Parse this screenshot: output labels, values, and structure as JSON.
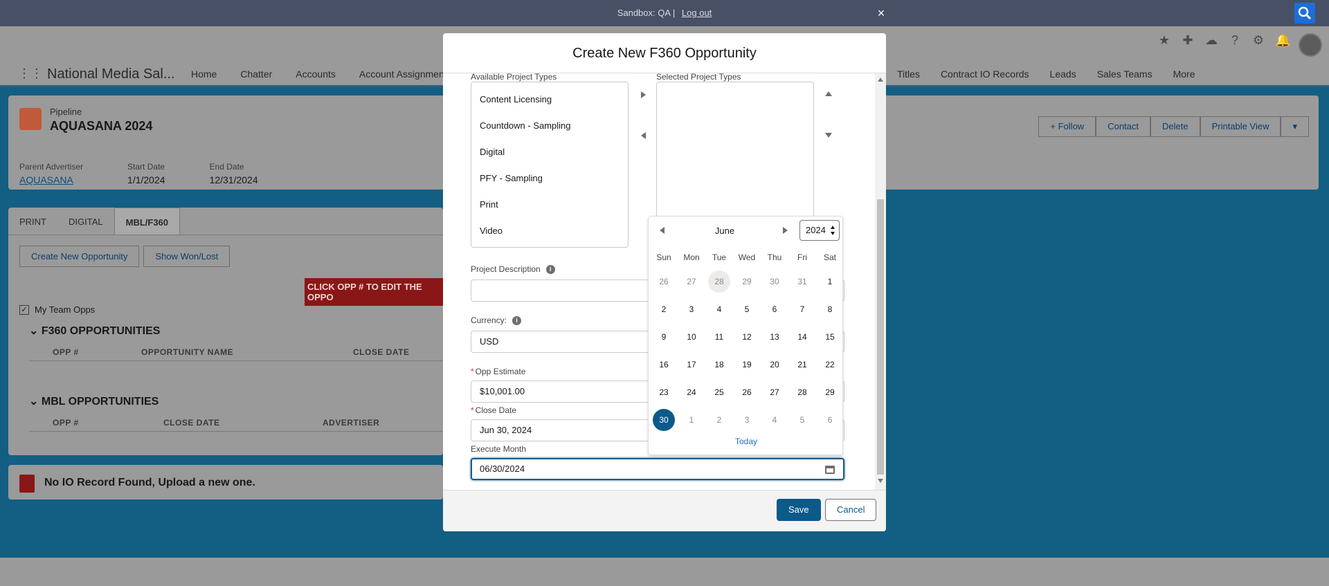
{
  "topbar": {
    "sandbox": "Sandbox: QA |",
    "logout": "Log out",
    "close": "×"
  },
  "nav": {
    "app_name": "National Media Sal...",
    "items": [
      "Home",
      "Chatter",
      "Accounts",
      "Account Assignments"
    ],
    "items_right": [
      "Titles",
      "Contract IO Records",
      "Leads",
      "Sales Teams",
      "More"
    ]
  },
  "record": {
    "type": "Pipeline",
    "name": "AQUASANA 2024",
    "fields": [
      {
        "label": "Parent Advertiser",
        "value": "AQUASANA"
      },
      {
        "label": "Start Date",
        "value": "1/1/2024"
      },
      {
        "label": "End Date",
        "value": "12/31/2024"
      }
    ],
    "actions": {
      "follow": "+ Follow",
      "contact": "Contact",
      "delete": "Delete",
      "printable": "Printable View"
    }
  },
  "tabs": [
    "PRINT",
    "DIGITAL",
    "MBL/F360"
  ],
  "tab_buttons": {
    "create": "Create New Opportunity",
    "won_lost": "Show Won/Lost"
  },
  "banner": "CLICK OPP # TO EDIT THE OPPO",
  "my_team_opps": "My Team Opps",
  "f360": {
    "title": "F360 OPPORTUNITIES",
    "cols": [
      "OPP #",
      "OPPORTUNITY NAME",
      "CLOSE DATE"
    ]
  },
  "mbl": {
    "title": "MBL OPPORTUNITIES",
    "cols": [
      "OPP #",
      "CLOSE DATE",
      "ADVERTISER"
    ]
  },
  "io_record": "No IO Record Found, Upload a new one.",
  "modal": {
    "title": "Create New F360 Opportunity",
    "available_label": "Available Project Types",
    "selected_label": "Selected Project Types",
    "available_options": [
      "Content Licensing",
      "Countdown - Sampling",
      "Digital",
      "PFY - Sampling",
      "Print",
      "Video"
    ],
    "project_description_label": "Project Description",
    "project_description_value": "",
    "currency_label": "Currency:",
    "currency_value": "USD",
    "opp_estimate_label": "Opp Estimate",
    "opp_estimate_value": "$10,001.00",
    "close_date_label": "Close Date",
    "close_date_value": "Jun 30, 2024",
    "execute_month_label": "Execute Month",
    "execute_month_value": "06/30/2024",
    "save": "Save",
    "cancel": "Cancel"
  },
  "datepicker": {
    "month": "June",
    "year": "2024",
    "weekdays": [
      "Sun",
      "Mon",
      "Tue",
      "Wed",
      "Thu",
      "Fri",
      "Sat"
    ],
    "weeks": [
      [
        "26",
        "27",
        "28",
        "29",
        "30",
        "31",
        "1"
      ],
      [
        "2",
        "3",
        "4",
        "5",
        "6",
        "7",
        "8"
      ],
      [
        "9",
        "10",
        "11",
        "12",
        "13",
        "14",
        "15"
      ],
      [
        "16",
        "17",
        "18",
        "19",
        "20",
        "21",
        "22"
      ],
      [
        "23",
        "24",
        "25",
        "26",
        "27",
        "28",
        "29"
      ],
      [
        "30",
        "1",
        "2",
        "3",
        "4",
        "5",
        "6"
      ]
    ],
    "today_label": "Today",
    "selected_day": "30"
  }
}
